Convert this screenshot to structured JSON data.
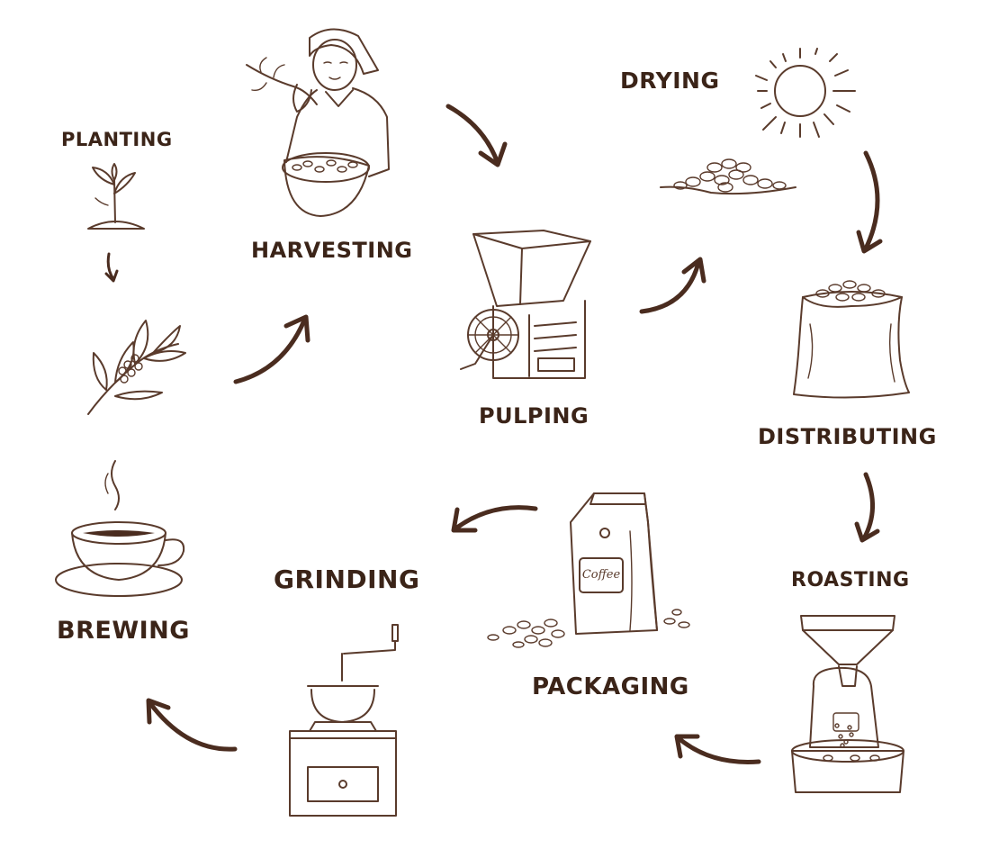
{
  "steps": {
    "planting": "PLANTING",
    "harvesting": "HARVESTING",
    "drying": "DRYING",
    "pulping": "PULPING",
    "distributing": "DISTRIBUTING",
    "roasting": "ROASTING",
    "packaging": "PACKAGING",
    "grinding": "GRINDING",
    "brewing": "BREWING"
  },
  "bag_label": "Coffee",
  "colors": {
    "ink": "#5a3b2c",
    "arrow": "#4a2c1f",
    "text": "#3b2418"
  },
  "icons": [
    "seedling-icon",
    "coffee-branch-icon",
    "farmer-harvesting-icon",
    "sun-icon",
    "bean-pile-icon",
    "pulping-machine-icon",
    "sack-icon",
    "roaster-icon",
    "coffee-bag-icon",
    "grinder-icon",
    "coffee-cup-icon"
  ]
}
